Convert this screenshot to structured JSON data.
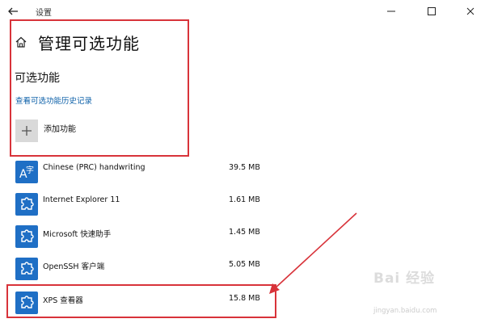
{
  "window": {
    "title": "设置"
  },
  "header": {
    "title": "管理可选功能"
  },
  "section": {
    "title": "可选功能",
    "history_link": "查看可选功能历史记录",
    "add_label": "添加功能"
  },
  "features": [
    {
      "name": "Chinese (PRC) handwriting",
      "size": "39.5 MB",
      "icon": "handwriting-icon"
    },
    {
      "name": "Internet Explorer 11",
      "size": "1.61 MB",
      "icon": "puzzle-icon"
    },
    {
      "name": "Microsoft 快速助手",
      "size": "1.45 MB",
      "icon": "puzzle-icon"
    },
    {
      "name": "OpenSSH 客户端",
      "size": "5.05 MB",
      "icon": "puzzle-icon"
    },
    {
      "name": "XPS 查看器",
      "size": "15.8 MB",
      "icon": "puzzle-icon"
    }
  ],
  "annotation": {
    "color": "#d8333a"
  },
  "accent": "#1f6fc5",
  "watermark": {
    "logo": "Bai 经验",
    "url": "jingyan.baidu.com"
  }
}
